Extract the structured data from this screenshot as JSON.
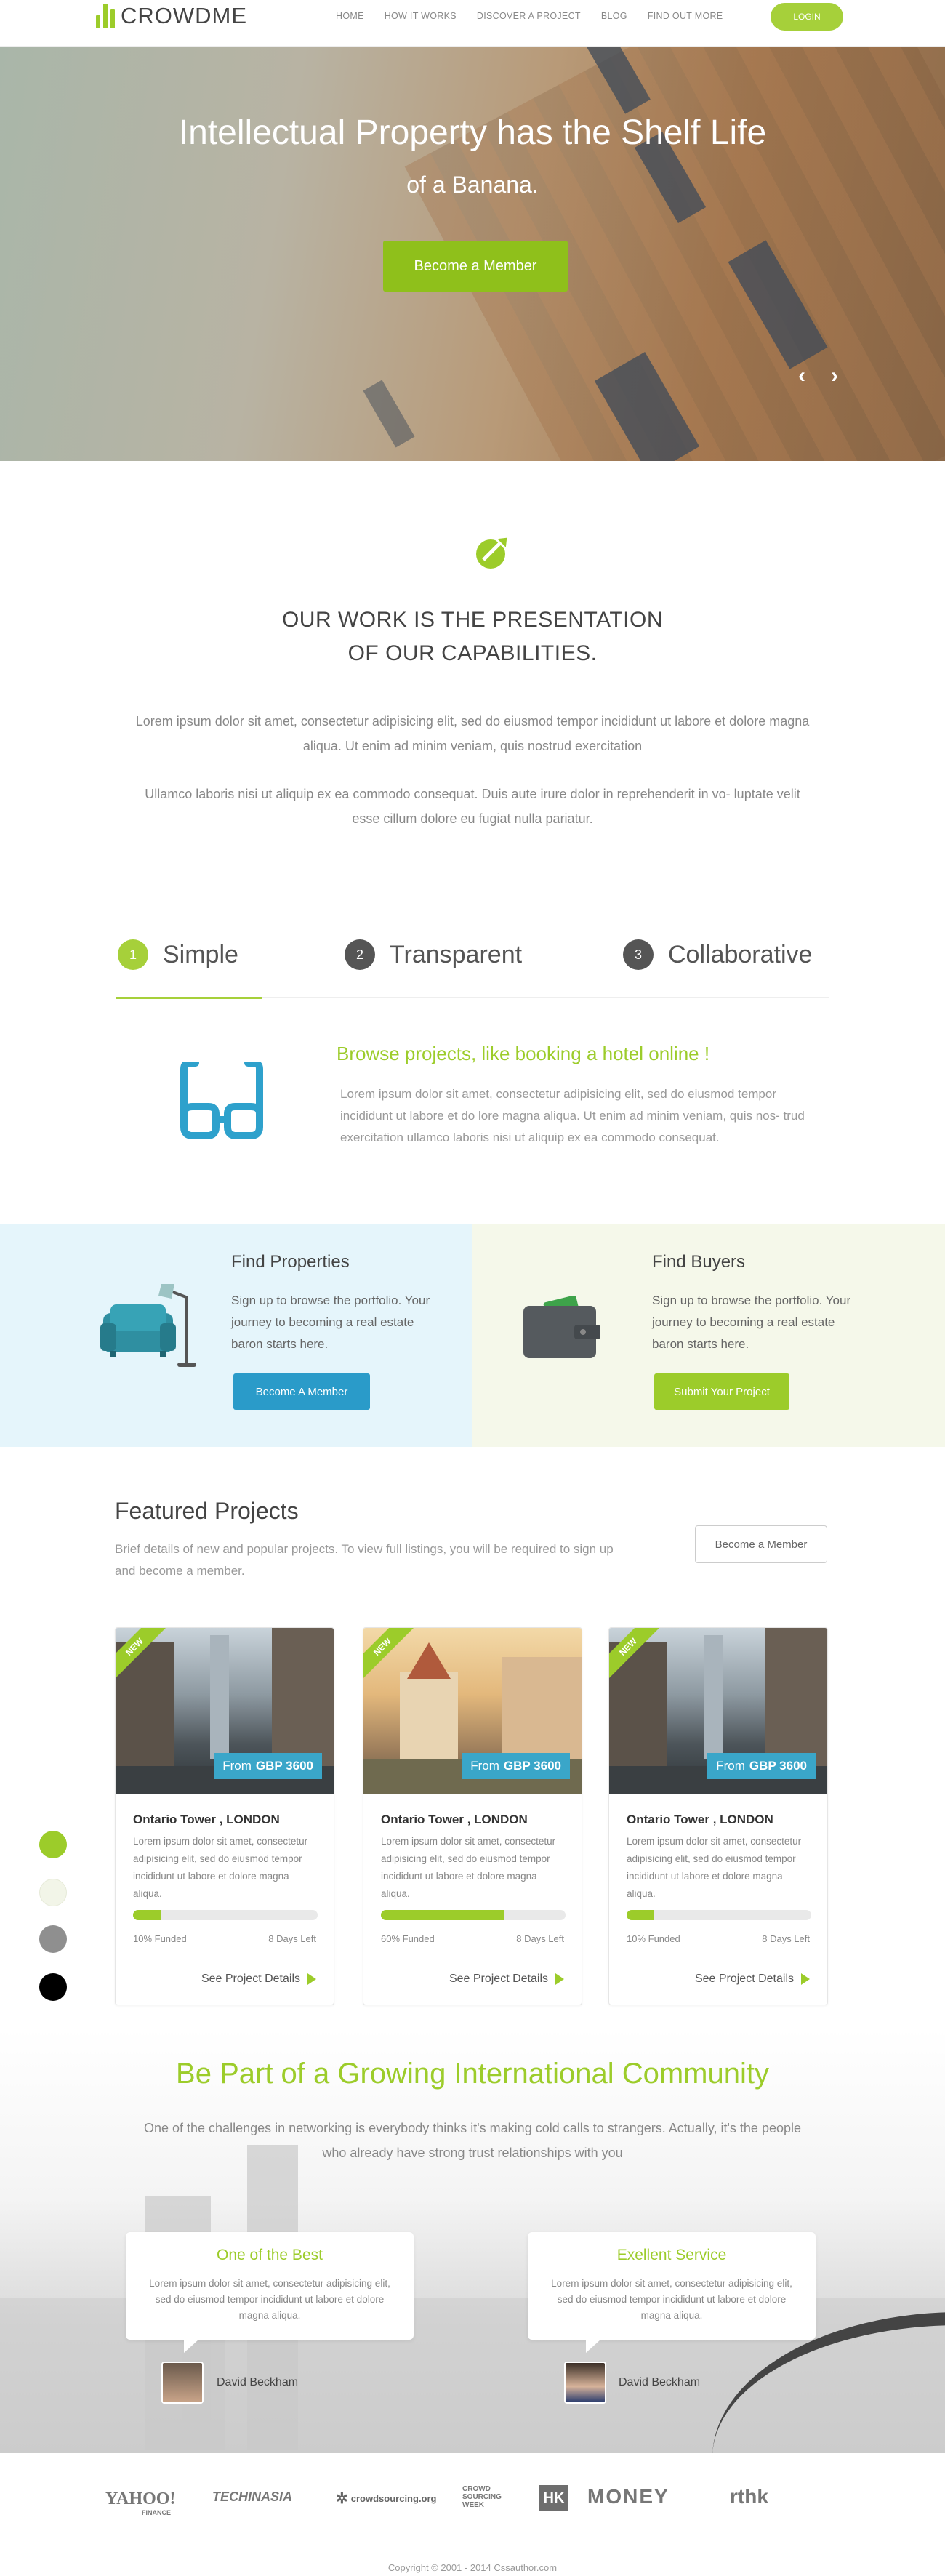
{
  "header": {
    "brand": "CROWDME",
    "nav": [
      "HOME",
      "HOW IT WORKS",
      "DISCOVER A PROJECT",
      "BLOG",
      "FIND OUT MORE"
    ],
    "login": "LOGIN"
  },
  "hero": {
    "title": "Intellectual Property has the Shelf Life",
    "subtitle": "of a Banana.",
    "cta": "Become a Member",
    "prev_icon": "chevron-left-icon",
    "next_icon": "chevron-right-icon"
  },
  "capabilities": {
    "title_line1": "OUR WORK IS THE PRESENTATION",
    "title_line2": "OF OUR CAPABILITIES.",
    "p1": "Lorem ipsum dolor sit amet, consectetur adipisicing elit, sed do eiusmod tempor incididunt ut labore et dolore magna aliqua. Ut enim ad minim veniam, quis nostrud exercitation",
    "p2": "Ullamco laboris nisi ut aliquip ex ea commodo consequat. Duis aute irure dolor in reprehenderit in vo- luptate velit esse cillum dolore eu fugiat nulla pariatur."
  },
  "steps": [
    {
      "num": "1",
      "label": "Simple",
      "color": "#a6d03a"
    },
    {
      "num": "2",
      "label": "Transparent",
      "color": "#555555"
    },
    {
      "num": "3",
      "label": "Collaborative",
      "color": "#555555"
    }
  ],
  "browse": {
    "title": "Browse projects, like booking a hotel online !",
    "text": "Lorem ipsum dolor sit amet, consectetur adipisicing elit, sed do eiusmod tempor incididunt ut labore et do lore magna aliqua. Ut enim ad minim veniam, quis nos- trud exercitation ullamco laboris nisi ut aliquip ex ea commodo consequat."
  },
  "find_properties": {
    "title": "Find Properties",
    "text": "Sign up to browse the portfolio. Your journey to becoming a real estate baron starts here.",
    "button": "Become A Member"
  },
  "find_buyers": {
    "title": "Find Buyers",
    "text": "Sign up to browse the portfolio. Your journey to becoming a real estate baron starts here.",
    "button": "Submit Your Project"
  },
  "featured": {
    "title": "Featured Projects",
    "subtitle": "Brief details of new and popular projects. To view full listings, you will be required to sign up and become a member.",
    "button": "Become a Member",
    "cards": [
      {
        "badge": "NEW",
        "price_prefix": "From",
        "price": "GBP 3600",
        "title": "Ontario Tower , LONDON",
        "desc": "Lorem ipsum dolor sit amet, consectetur adipisicing elit, sed do eiusmod tempor incididunt ut labore et dolore magna aliqua.",
        "funded": "10% Funded",
        "funded_fraction": 0.15,
        "days": "8 Days Left",
        "link": "See Project Details"
      },
      {
        "badge": "NEW",
        "price_prefix": "From",
        "price": "GBP 3600",
        "title": "Ontario Tower , LONDON",
        "desc": "Lorem ipsum dolor sit amet, consectetur adipisicing elit, sed do eiusmod tempor incididunt ut labore et dolore magna aliqua.",
        "funded": "60% Funded",
        "funded_fraction": 0.67,
        "days": "8 Days Left",
        "link": "See Project Details"
      },
      {
        "badge": "NEW",
        "price_prefix": "From",
        "price": "GBP 3600",
        "title": "Ontario Tower , LONDON",
        "desc": "Lorem ipsum dolor sit amet, consectetur adipisicing elit, sed do eiusmod tempor incididunt ut labore et dolore magna aliqua.",
        "funded": "10% Funded",
        "funded_fraction": 0.15,
        "days": "8 Days Left",
        "link": "See Project Details"
      }
    ]
  },
  "swatches": [
    "#9ccc2a",
    "#f2f5e8",
    "#8f8f8f",
    "#000000"
  ],
  "community": {
    "title": "Be Part of a Growing International Community",
    "subtitle": "One of the challenges in networking is everybody thinks it's making cold calls to strangers. Actually, it's the people who already have strong trust relationships with you",
    "quotes": [
      {
        "title": "One of the Best",
        "text": "Lorem ipsum dolor sit amet, consectetur adipisicing elit, sed do eiusmod tempor incididunt ut labore et dolore magna aliqua.",
        "author": "David Beckham"
      },
      {
        "title": "Exellent Service",
        "text": "Lorem ipsum dolor sit amet, consectetur adipisicing elit, sed do eiusmod tempor incididunt ut labore et dolore magna aliqua.",
        "author": "David Beckham"
      }
    ]
  },
  "partners": [
    "YAHOO!",
    "TECHINASIA",
    "crowdsourcing.org",
    "CROWD SOURCING WEEK",
    "HK",
    "MONEY",
    "rthk"
  ],
  "partner_sub": {
    "yahoo": "FINANCE"
  },
  "footer": {
    "copyright": "Copyright © 2001 - 2014  Cssauthor.com"
  },
  "colors": {
    "accent": "#9ccc2a",
    "blue": "#3aa6c9",
    "button_blue": "#2a9bc9"
  }
}
